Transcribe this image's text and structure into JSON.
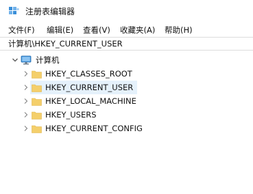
{
  "window": {
    "title": "注册表编辑器",
    "app_icon": "registry-editor-icon"
  },
  "menu": {
    "items": [
      {
        "label": "文件(F)"
      },
      {
        "label": "编辑(E)"
      },
      {
        "label": "查看(V)"
      },
      {
        "label": "收藏夹(A)"
      },
      {
        "label": "帮助(H)"
      }
    ]
  },
  "address": {
    "path": "计算机\\HKEY_CURRENT_USER"
  },
  "tree": {
    "root": {
      "label": "计算机",
      "icon": "computer-icon",
      "expanded": true
    },
    "children": [
      {
        "label": "HKEY_CLASSES_ROOT",
        "icon": "folder-icon",
        "selected": false
      },
      {
        "label": "HKEY_CURRENT_USER",
        "icon": "folder-icon",
        "selected": true
      },
      {
        "label": "HKEY_LOCAL_MACHINE",
        "icon": "folder-icon",
        "selected": false
      },
      {
        "label": "HKEY_USERS",
        "icon": "folder-icon",
        "selected": false
      },
      {
        "label": "HKEY_CURRENT_CONFIG",
        "icon": "folder-icon",
        "selected": false
      }
    ]
  },
  "colors": {
    "folder": "#f4cf6b",
    "selection": "#e5f1fb",
    "computer": "#3a8fd8"
  }
}
